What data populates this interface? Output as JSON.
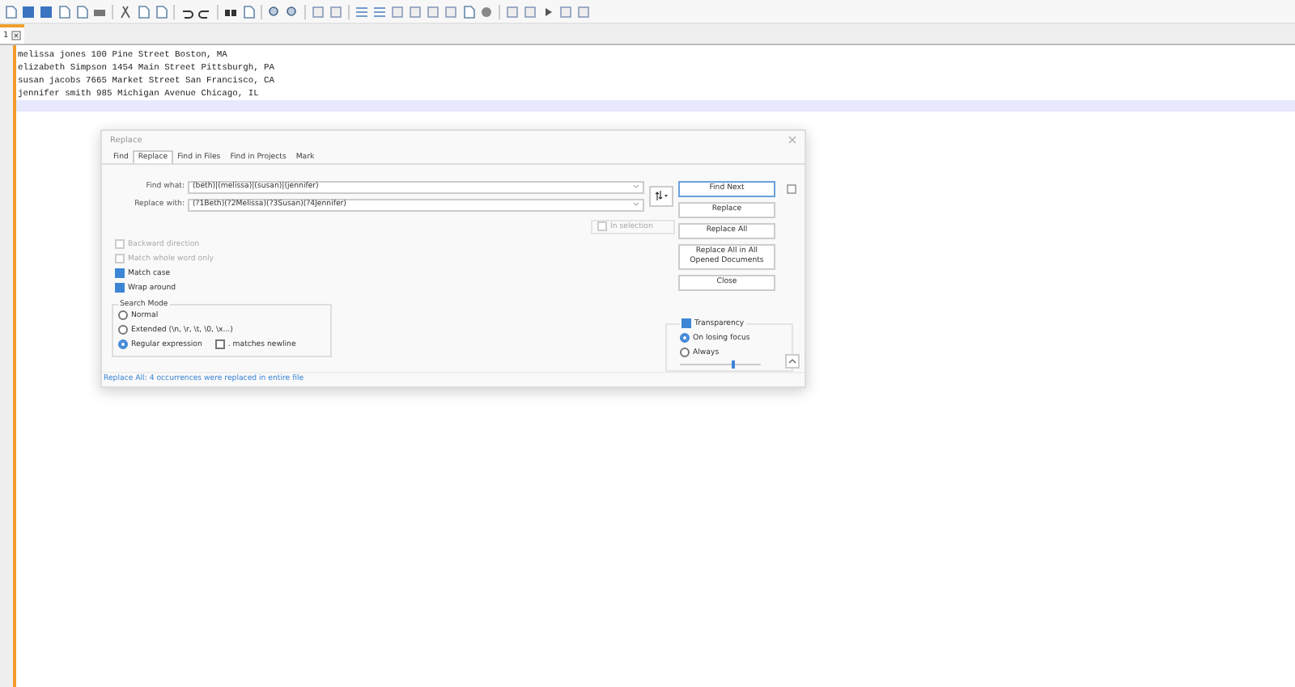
{
  "tabs": [
    {
      "label": "1",
      "selected": true
    }
  ],
  "editor": {
    "lines": [
      "melissa jones 100 Pine Street Boston, MA",
      "elizabeth Simpson 1454 Main Street Pittsburgh, PA",
      "susan jacobs 7665 Market Street San Francisco, CA",
      "jennifer smith 985 Michigan Avenue Chicago, IL"
    ]
  },
  "dialog": {
    "title": "Replace",
    "tabs": [
      {
        "label": "Find",
        "selected": false
      },
      {
        "label": "Replace",
        "selected": true
      },
      {
        "label": "Find in Files",
        "selected": false
      },
      {
        "label": "Find in Projects",
        "selected": false
      },
      {
        "label": "Mark",
        "selected": false
      }
    ],
    "fields": [
      {
        "label": "Find what:",
        "value": "(beth)|(melissa)|(susan)|(jennifer)"
      },
      {
        "label": "Replace with:",
        "value": "(?1Beth)(?2Melissa)(?3Susan)(?4Jennifer)"
      }
    ],
    "in_selection": {
      "label": "In selection",
      "checked": false,
      "disabled": true
    },
    "buttons": [
      {
        "label": "Find Next",
        "selected": true
      },
      {
        "label": "Replace",
        "selected": false
      },
      {
        "label": "Replace All",
        "selected": false
      },
      {
        "label": "Replace All in All Opened Documents",
        "selected": false
      },
      {
        "label": "Close",
        "selected": false
      }
    ],
    "options": [
      {
        "label": "Backward direction",
        "checked": false,
        "disabled": true
      },
      {
        "label": "Match whole word only",
        "checked": false,
        "disabled": true
      },
      {
        "label": "Match case",
        "checked": true,
        "disabled": false
      },
      {
        "label": "Wrap around",
        "checked": true,
        "disabled": false
      }
    ],
    "search_mode": {
      "title": "Search Mode",
      "options": [
        {
          "label": "Normal",
          "selected": false
        },
        {
          "label": "Extended (\\n, \\r, \\t, \\0, \\x...)",
          "selected": false
        },
        {
          "label": "Regular expression",
          "selected": true
        }
      ],
      "matches_newline": {
        "label": ". matches newline",
        "checked": false
      }
    },
    "transparency": {
      "label": "Transparency",
      "checked": true,
      "options": [
        {
          "label": "On losing focus",
          "selected": true
        },
        {
          "label": "Always",
          "selected": false
        }
      ],
      "level": 0.65
    },
    "status": "Replace All: 4 occurrences were replaced in entire file"
  }
}
